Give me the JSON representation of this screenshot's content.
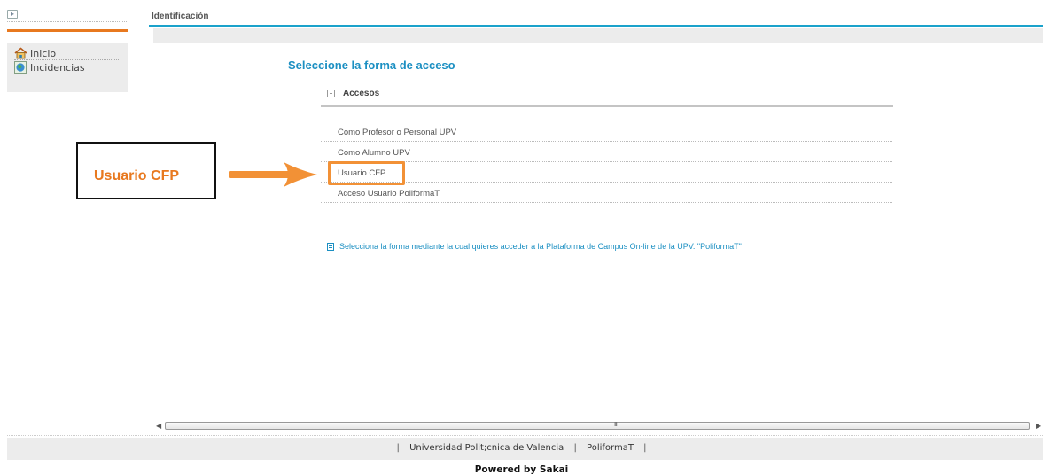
{
  "header": {
    "title": "Identificación"
  },
  "sidebar": {
    "items": [
      {
        "label": "Inicio",
        "icon": "home-icon"
      },
      {
        "label": "Incidencias",
        "icon": "globe-icon"
      }
    ]
  },
  "main": {
    "title": "Seleccione la forma de acceso",
    "section_title": "Accesos",
    "access_options": [
      "Como Profesor o Personal UPV",
      "Como Alumno UPV",
      "Usuario CFP",
      "Acceso Usuario PoliformaT"
    ],
    "info_text": "Selecciona la forma mediante la cual quieres acceder a la Plataforma de Campus On-line de la UPV. \"PoliformaT\""
  },
  "annotation": {
    "label": "Usuario CFP",
    "color": "#e8791f"
  },
  "scrollbar": {
    "grip": "III"
  },
  "footer": {
    "links": [
      "Universidad Polit;cnica de Valencia",
      "PoliformaT"
    ],
    "powered_by": "Powered by Sakai"
  },
  "colors": {
    "accent": "#1ba2cb",
    "orange": "#e8791f",
    "link": "#1b8fc2"
  }
}
